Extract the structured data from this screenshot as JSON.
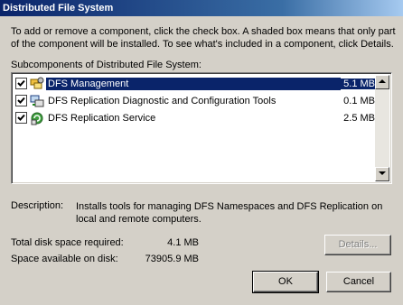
{
  "window": {
    "title": "Distributed File System"
  },
  "instructions": "To add or remove a component, click the check box. A shaded box means that only part of the component will be installed. To see what's included in a component, click Details.",
  "subcomponents_label": "Subcomponents of Distributed File System:",
  "components": [
    {
      "label": "DFS Management",
      "size": "5.1 MB",
      "checked": true,
      "icon": "dfs-management-icon"
    },
    {
      "label": "DFS Replication Diagnostic and Configuration Tools",
      "size": "0.1 MB",
      "checked": true,
      "icon": "dfs-tools-icon"
    },
    {
      "label": "DFS Replication Service",
      "size": "2.5 MB",
      "checked": true,
      "icon": "dfs-service-icon"
    }
  ],
  "description": {
    "label": "Description:",
    "text": "Installs tools for managing DFS Namespaces and DFS Replication on local and remote computers."
  },
  "disk": {
    "required_label": "Total disk space required:",
    "required_value": "4.1 MB",
    "available_label": "Space available on disk:",
    "available_value": "73905.9 MB"
  },
  "buttons": {
    "details": "Details...",
    "ok": "OK",
    "cancel": "Cancel"
  },
  "colors": {
    "selection": "#0a246a",
    "dialog": "#d4d0c8"
  }
}
